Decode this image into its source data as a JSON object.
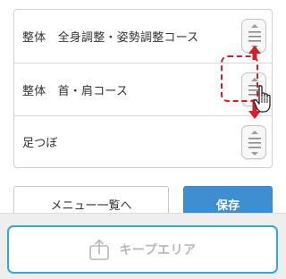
{
  "menu_list": {
    "items": [
      {
        "label": "整体　全身調整・姿勢調整コース"
      },
      {
        "label": "整体　首・肩コース"
      },
      {
        "label": "足つぼ"
      }
    ]
  },
  "actions": {
    "menu_list_label": "メニュー一覧へ",
    "save_label": "保存"
  },
  "keep_area": {
    "label": "キープエリア",
    "icon": "keep-area-icon"
  },
  "icons": {
    "drag_handle": "drag-handle-icon",
    "move_arrows": "up-down-arrow-icon",
    "cursor": "hand-cursor-icon"
  },
  "colors": {
    "save_button": "#3e8ed0",
    "keep_area_border": "#2ea8e8",
    "drag_highlight": "#d11f2b",
    "disabled_text": "#b8b8b8"
  }
}
